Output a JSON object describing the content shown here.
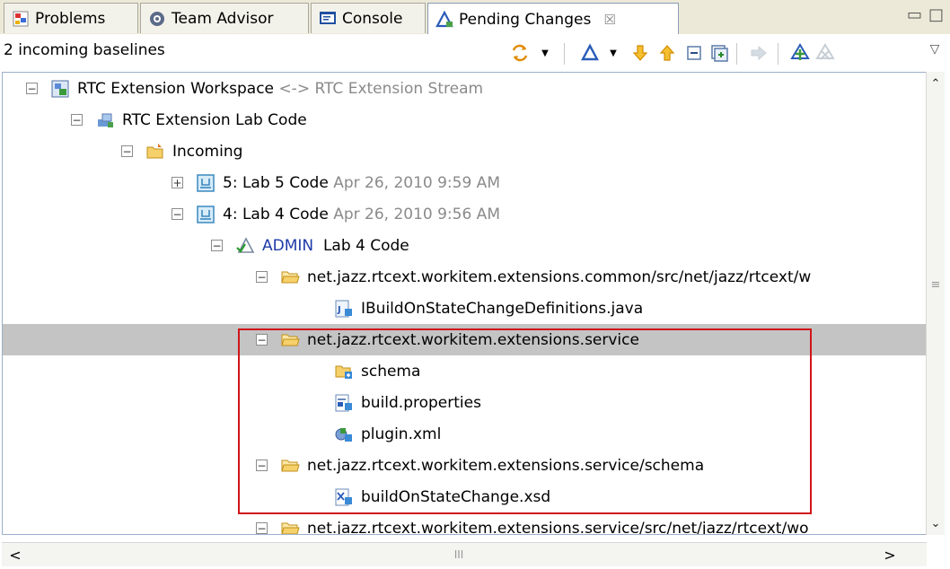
{
  "tabs": [
    {
      "label": "Problems",
      "icon": "problems-icon"
    },
    {
      "label": "Team Advisor",
      "icon": "team-advisor-icon"
    },
    {
      "label": "Console",
      "icon": "console-icon"
    },
    {
      "label": "Pending Changes",
      "icon": "pending-changes-icon",
      "close": "☒"
    }
  ],
  "window_controls": {
    "minimize": "▭",
    "maximize": "□"
  },
  "toolbar": {
    "title": "2 incoming baselines",
    "view_menu": "▽"
  },
  "tree": {
    "rows": [
      {
        "name": "RTC Extension Workspace",
        "suffix": "<-> RTC Extension Stream",
        "icon": "workspace-icon",
        "expander": "−"
      },
      {
        "name": "RTC Extension Lab Code",
        "suffix": "",
        "icon": "component-icon",
        "expander": "−"
      },
      {
        "name": "Incoming",
        "suffix": "",
        "icon": "incoming-folder-icon",
        "expander": "−"
      },
      {
        "name": "5: Lab 5 Code",
        "suffix": "Apr 26, 2010 9:59 AM",
        "icon": "baseline-icon",
        "expander": "+"
      },
      {
        "name": "4: Lab 4 Code",
        "suffix": "Apr 26, 2010 9:56 AM",
        "icon": "baseline-icon",
        "expander": "−"
      },
      {
        "prefix": "ADMIN",
        "name": "Lab 4 Code",
        "suffix": "",
        "icon": "change-set-icon",
        "expander": "−"
      },
      {
        "name": "net.jazz.rtcext.workitem.extensions.common/src/net/jazz/rtcext/w",
        "suffix": "",
        "icon": "folder-icon",
        "expander": "−"
      },
      {
        "name": "IBuildOnStateChangeDefinitions.java",
        "suffix": "",
        "icon": "java-file-icon",
        "expander": ""
      },
      {
        "name": "net.jazz.rtcext.workitem.extensions.service",
        "suffix": "",
        "icon": "folder-icon",
        "expander": "−"
      },
      {
        "name": "schema",
        "suffix": "",
        "icon": "folder-add-icon",
        "expander": ""
      },
      {
        "name": "build.properties",
        "suffix": "",
        "icon": "properties-file-icon",
        "expander": ""
      },
      {
        "name": "plugin.xml",
        "suffix": "",
        "icon": "plugin-file-icon",
        "expander": ""
      },
      {
        "name": "net.jazz.rtcext.workitem.extensions.service/schema",
        "suffix": "",
        "icon": "folder-icon",
        "expander": "−"
      },
      {
        "name": "buildOnStateChange.xsd",
        "suffix": "",
        "icon": "xsd-file-icon",
        "expander": ""
      },
      {
        "name": "net.jazz.rtcext.workitem.extensions.service/src/net/jazz/rtcext/wo",
        "suffix": "",
        "icon": "folder-icon",
        "expander": "−"
      }
    ]
  },
  "scroll": {
    "up": "⌃",
    "down": "⌄",
    "left": "<",
    "right": ">",
    "thumb": "III",
    "vthumb": "≡"
  },
  "colors": {
    "highlight_box": "#d0141a",
    "selected_row": "#c4c4c4"
  }
}
